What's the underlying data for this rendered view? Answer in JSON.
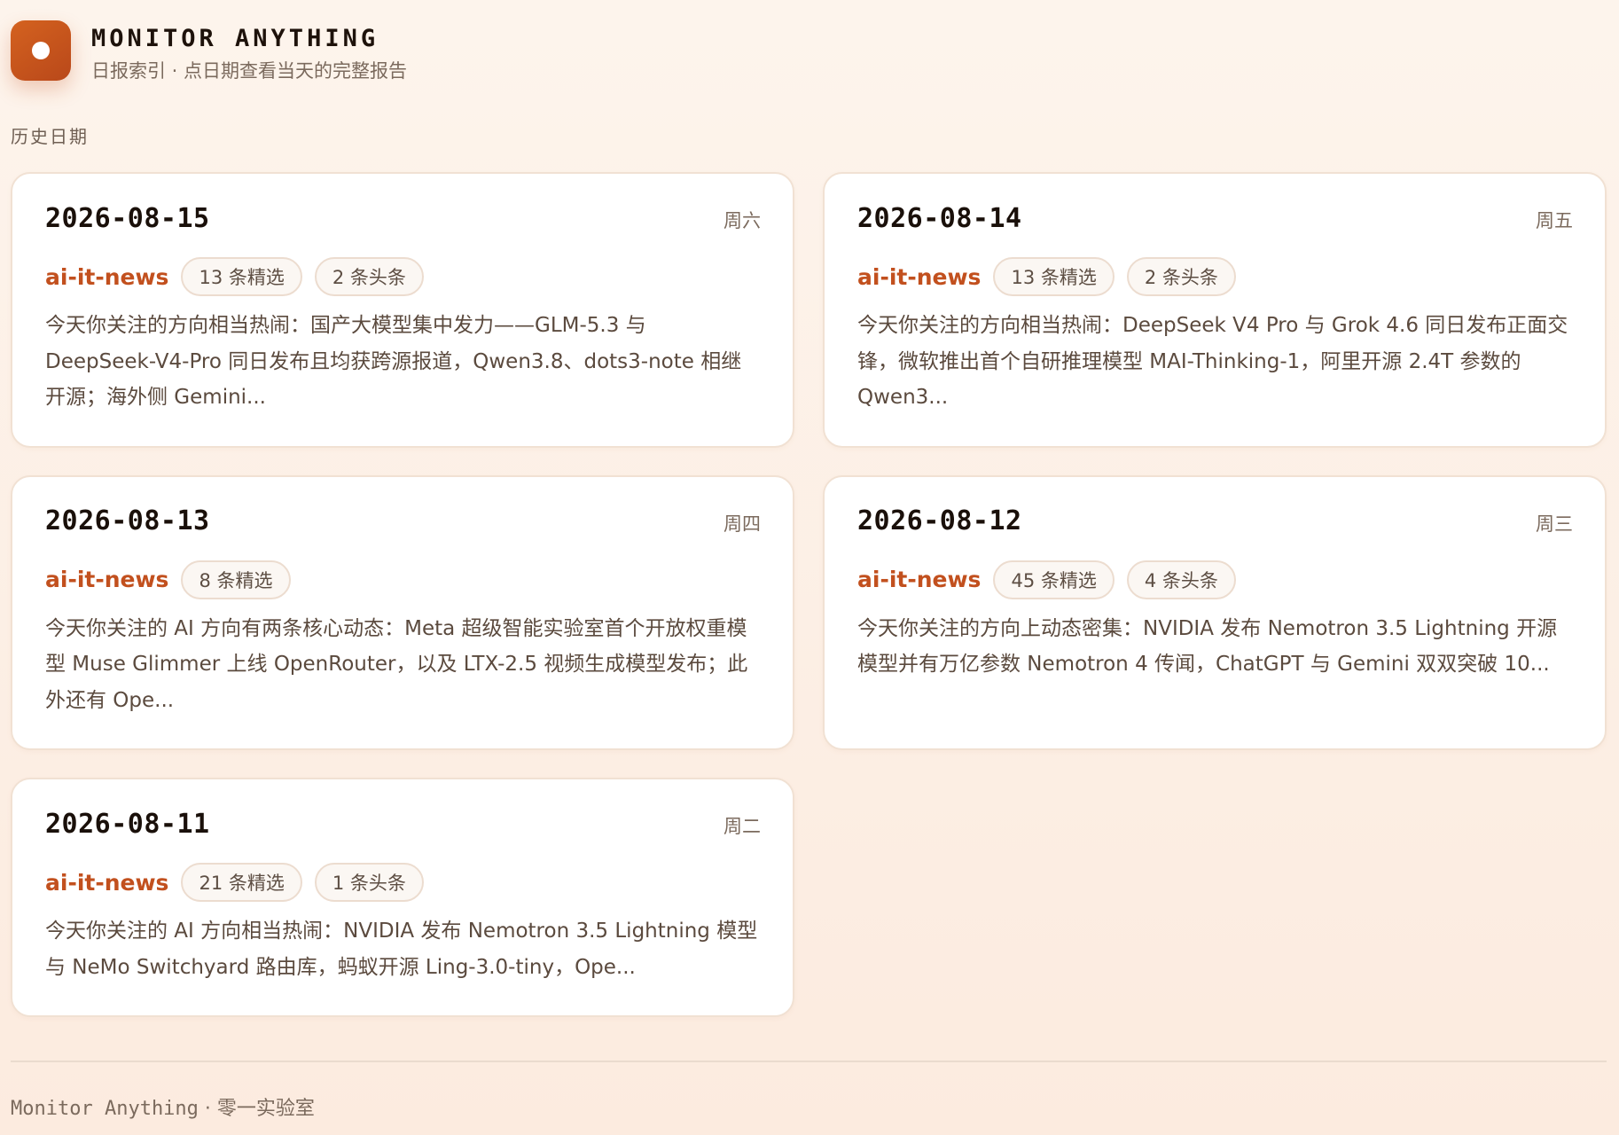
{
  "header": {
    "logo_icon": "record-dot-icon",
    "title": "MONITOR ANYTHING",
    "subtitle": "日报索引 · 点日期查看当天的完整报告"
  },
  "section_label": "历史日期",
  "reports": [
    {
      "date": "2026-08-15",
      "weekday": "周六",
      "source": "ai-it-news",
      "tags": [
        "13 条精选",
        "2 条头条"
      ],
      "summary": "今天你关注的方向相当热闹：国产大模型集中发力——GLM-5.3 与 DeepSeek-V4-Pro 同日发布且均获跨源报道，Qwen3.8、dots3-note 相继开源；海外侧 Gemini..."
    },
    {
      "date": "2026-08-14",
      "weekday": "周五",
      "source": "ai-it-news",
      "tags": [
        "13 条精选",
        "2 条头条"
      ],
      "summary": "今天你关注的方向相当热闹：DeepSeek V4 Pro 与 Grok 4.6 同日发布正面交锋，微软推出首个自研推理模型 MAI-Thinking-1，阿里开源 2.4T 参数的 Qwen3..."
    },
    {
      "date": "2026-08-13",
      "weekday": "周四",
      "source": "ai-it-news",
      "tags": [
        "8 条精选"
      ],
      "summary": "今天你关注的 AI 方向有两条核心动态：Meta 超级智能实验室首个开放权重模型 Muse Glimmer 上线 OpenRouter，以及 LTX-2.5 视频生成模型发布；此外还有 Ope..."
    },
    {
      "date": "2026-08-12",
      "weekday": "周三",
      "source": "ai-it-news",
      "tags": [
        "45 条精选",
        "4 条头条"
      ],
      "summary": "今天你关注的方向上动态密集：NVIDIA 发布 Nemotron 3.5 Lightning 开源模型并有万亿参数 Nemotron 4 传闻，ChatGPT 与 Gemini 双双突破 10..."
    },
    {
      "date": "2026-08-11",
      "weekday": "周二",
      "source": "ai-it-news",
      "tags": [
        "21 条精选",
        "1 条头条"
      ],
      "summary": "今天你关注的 AI 方向相当热闹：NVIDIA 发布 Nemotron 3.5 Lightning 模型与 NeMo Switchyard 路由库，蚂蚁开源 Ling-3.0-tiny，Ope..."
    }
  ],
  "footer": {
    "brand": "Monitor Anything",
    "separator": " · ",
    "org": "零一实验室"
  }
}
